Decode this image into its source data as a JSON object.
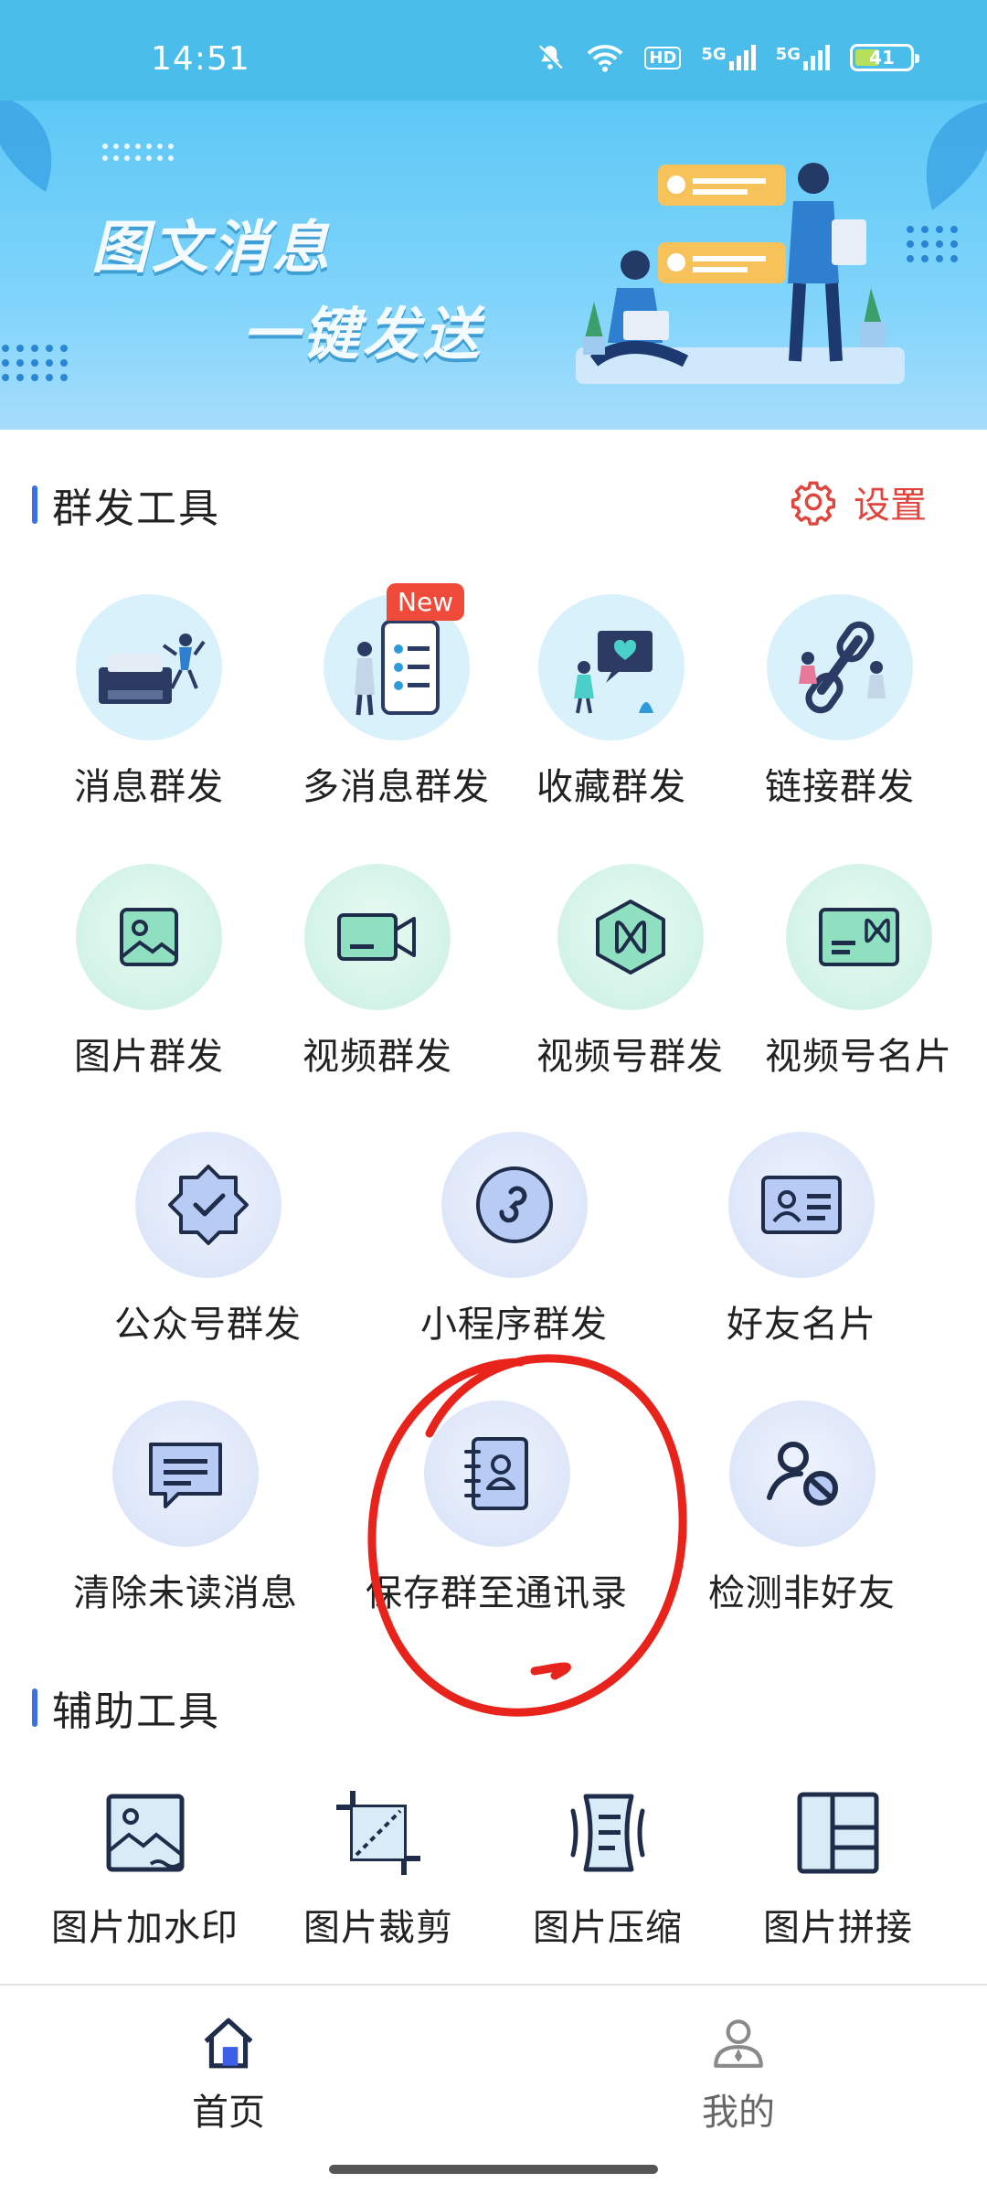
{
  "status_bar": {
    "time": "14:51",
    "icons": [
      "mute-icon",
      "wifi-icon",
      "hd-icon",
      "5g-signal-icon",
      "5g-signal-icon"
    ],
    "network_labels": [
      "HD",
      "5G",
      "5G"
    ],
    "battery_level": "41"
  },
  "banner": {
    "line1": "图文消息",
    "line2": "一键发送"
  },
  "section_group": {
    "title": "群发工具",
    "settings_label": "设置"
  },
  "tools": [
    {
      "label": "消息群发"
    },
    {
      "label": "多消息群发",
      "badge": "New"
    },
    {
      "label": "收藏群发"
    },
    {
      "label": "链接群发"
    },
    {
      "label": "图片群发"
    },
    {
      "label": "视频群发"
    },
    {
      "label": "视频号群发"
    },
    {
      "label": "视频号名片"
    },
    {
      "label": "公众号群发"
    },
    {
      "label": "小程序群发"
    },
    {
      "label": "好友名片"
    },
    {
      "label": "清除未读消息"
    },
    {
      "label": "保存群至通讯录"
    },
    {
      "label": "检测非好友"
    }
  ],
  "section_aux": {
    "title": "辅助工具",
    "items": [
      {
        "label": "图片加水印"
      },
      {
        "label": "图片裁剪"
      },
      {
        "label": "图片压缩"
      },
      {
        "label": "图片拼接"
      }
    ]
  },
  "bottom_nav": {
    "home": "首页",
    "mine": "我的"
  },
  "colors": {
    "accent_blue": "#3b6fe6",
    "settings_red": "#e0463d",
    "annotation_red": "#e8231b",
    "status_bar": "#4bbdea"
  }
}
